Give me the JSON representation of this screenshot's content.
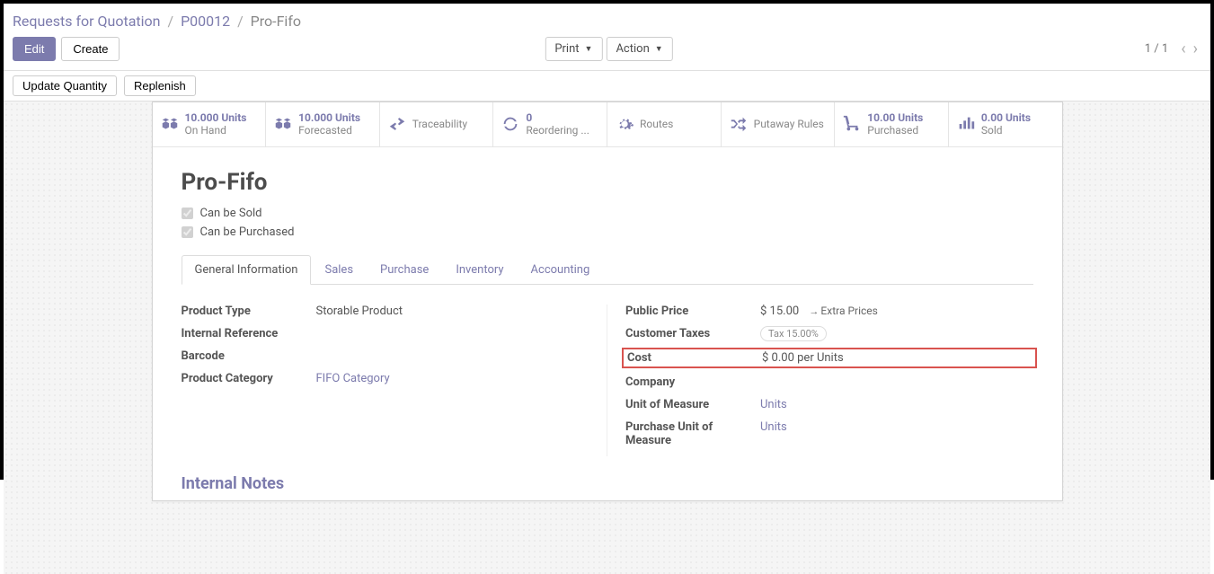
{
  "breadcrumb": {
    "root": "Requests for Quotation",
    "mid": "P00012",
    "current": "Pro-Fifo"
  },
  "buttons": {
    "edit": "Edit",
    "create": "Create",
    "print": "Print",
    "action": "Action",
    "update_qty": "Update Quantity",
    "replenish": "Replenish"
  },
  "pager": {
    "count": "1 / 1"
  },
  "statblocks": [
    {
      "icon": "cubes",
      "val": "10.000 Units",
      "lbl": "On Hand"
    },
    {
      "icon": "cubes",
      "val": "10.000 Units",
      "lbl": "Forecasted"
    },
    {
      "icon": "exchange",
      "val": "",
      "lbl": "Traceability"
    },
    {
      "icon": "refresh",
      "val": "0",
      "lbl": "Reordering ..."
    },
    {
      "icon": "cogs",
      "val": "",
      "lbl": "Routes"
    },
    {
      "icon": "random",
      "val": "",
      "lbl": "Putaway Rules"
    },
    {
      "icon": "cart",
      "val": "10.00 Units",
      "lbl": "Purchased"
    },
    {
      "icon": "bars",
      "val": "0.00 Units",
      "lbl": "Sold"
    }
  ],
  "product": {
    "name": "Pro-Fifo",
    "can_be_sold": "Can be Sold",
    "can_be_purchased": "Can be Purchased"
  },
  "tabs": [
    "General Information",
    "Sales",
    "Purchase",
    "Inventory",
    "Accounting"
  ],
  "left_col": {
    "product_type": {
      "label": "Product Type",
      "value": "Storable Product"
    },
    "internal_ref": {
      "label": "Internal Reference",
      "value": ""
    },
    "barcode": {
      "label": "Barcode",
      "value": ""
    },
    "category": {
      "label": "Product Category",
      "value": "FIFO Category"
    }
  },
  "right_col": {
    "public_price": {
      "label": "Public Price",
      "value": "$ 15.00",
      "extra": "Extra Prices"
    },
    "customer_taxes": {
      "label": "Customer Taxes",
      "value": "Tax 15.00%"
    },
    "cost": {
      "label": "Cost",
      "value": "$ 0.00",
      "suffix": "per Units"
    },
    "company": {
      "label": "Company",
      "value": ""
    },
    "uom": {
      "label": "Unit of Measure",
      "value": "Units"
    },
    "purchase_uom": {
      "label": "Purchase Unit of Measure",
      "value": "Units"
    }
  },
  "internal_notes": "Internal Notes"
}
